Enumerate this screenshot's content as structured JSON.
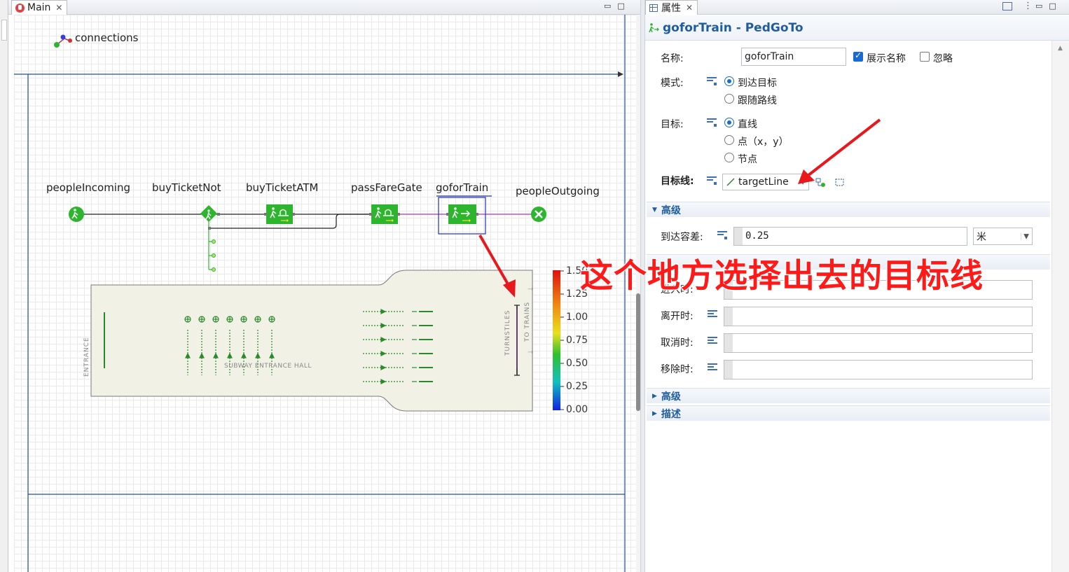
{
  "editor": {
    "tab_label": "Main",
    "tab_close": "✕",
    "win_min": "▭",
    "win_max": "□"
  },
  "canvas": {
    "connections_label": "connections",
    "nodes": [
      {
        "id": "peopleIncoming",
        "label": "peopleIncoming"
      },
      {
        "id": "buyTicketNot",
        "label": "buyTicketNot"
      },
      {
        "id": "buyTicketATM",
        "label": "buyTicketATM"
      },
      {
        "id": "passFareGate",
        "label": "passFareGate"
      },
      {
        "id": "goforTrain",
        "label": "goforTrain"
      },
      {
        "id": "peopleOutgoing",
        "label": "peopleOutgoing"
      }
    ],
    "hall_labels": {
      "entrance": "ENTRANCE",
      "hall": "SUBWAY ENTRANCE HALL",
      "turnstiles": "TURNSTILES",
      "to_trains": "TO TRAINS"
    },
    "legend_scale": [
      "1.50",
      "1.25",
      "1.00",
      "0.75",
      "0.50",
      "0.25",
      "0.00"
    ]
  },
  "props": {
    "tab_label": "属性",
    "tab_close": "✕",
    "header_title": "goforTrain - PedGoTo",
    "name_label": "名称:",
    "name_value": "goforTrain",
    "show_name_label": "展示名称",
    "ignore_label": "忽略",
    "mode_label": "模式:",
    "mode_options": [
      "到达目标",
      "跟随路线"
    ],
    "target_label": "目标:",
    "target_options": [
      "直线",
      "点（x，y）",
      "节点"
    ],
    "target_line_label": "目标线:",
    "target_line_value": "targetLine",
    "section_advanced_1": "高级",
    "arrival_tolerance_label": "到达容差:",
    "arrival_tolerance_value": "0.25",
    "unit_value": "米",
    "on_enter_label": "进入时:",
    "on_exit_label": "离开时:",
    "on_cancel_label": "取消时:",
    "on_remove_label": "移除时:",
    "section_advanced_2": "高级",
    "section_description": "描述"
  },
  "annotation": {
    "text": "这个地方选择出去的目标线"
  },
  "colors": {
    "accent_blue": "#1f5d9e",
    "node_green": "#2db52d",
    "annotation_red": "#ff1a1a"
  }
}
